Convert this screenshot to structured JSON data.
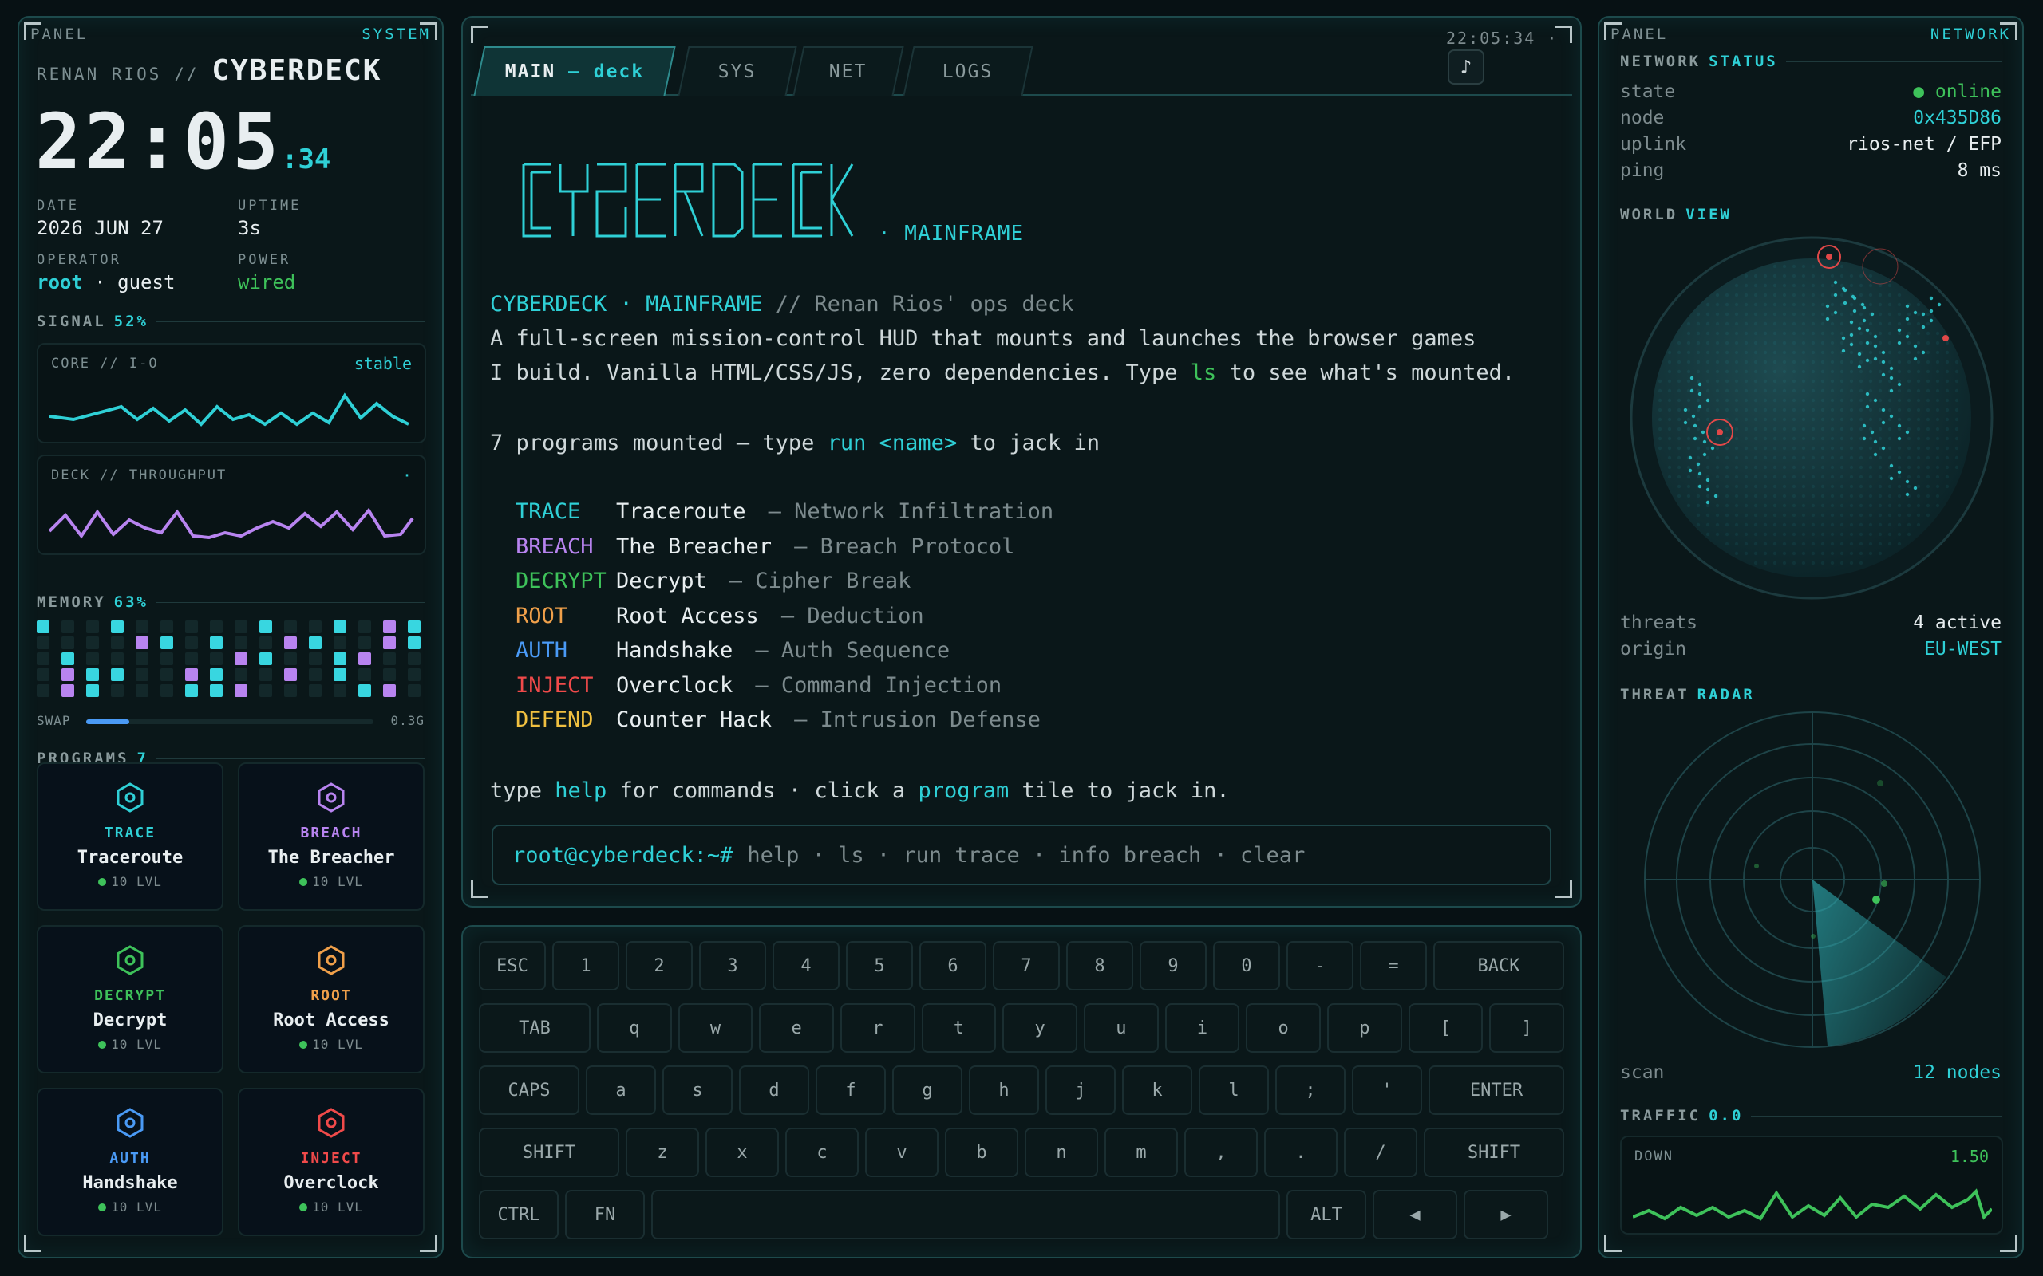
{
  "left": {
    "panel_label": "PANEL",
    "panel_tag": "SYSTEM",
    "owner": "RENAN RIOS //",
    "deck_name": "CYBERDECK",
    "clock_hm": "22:05",
    "clock_s": ":34",
    "date_label": "DATE",
    "date_value": "2026 JUN 27",
    "uptime_label": "UPTIME",
    "uptime_value": "3s",
    "operator_label": "OPERATOR",
    "operator_user": "root",
    "operator_sep": " · guest",
    "power_label": "POWER",
    "power_value": "wired",
    "signal_label": "SIGNAL",
    "signal_value": "52%",
    "core_label": "CORE // I-O",
    "core_status": "stable",
    "deck_label": "DECK // THROUGHPUT",
    "deck_status": "·",
    "memory_label": "MEMORY",
    "memory_value": "63%",
    "swap_label": "SWAP",
    "swap_value": "0.3G",
    "swap_fraction": 0.15,
    "programs_label": "PROGRAMS",
    "programs_count": "7",
    "programs": [
      {
        "code": "TRACE",
        "name": "Traceroute",
        "lvl": "10 LVL",
        "color": "#2fd0d6"
      },
      {
        "code": "BREACH",
        "name": "The Breacher",
        "lvl": "10 LVL",
        "color": "#b884f0"
      },
      {
        "code": "DECRYPT",
        "name": "Decrypt",
        "lvl": "10 LVL",
        "color": "#3ec25a"
      },
      {
        "code": "ROOT",
        "name": "Root Access",
        "lvl": "10 LVL",
        "color": "#f0a04a"
      },
      {
        "code": "AUTH",
        "name": "Handshake",
        "lvl": "10 LVL",
        "color": "#4a9af5"
      },
      {
        "code": "INJECT",
        "name": "Overclock",
        "lvl": "10 LVL",
        "color": "#f04a4a"
      }
    ]
  },
  "main": {
    "tabs": [
      {
        "label": "MAIN",
        "sub": " — deck"
      },
      {
        "label": "SYS"
      },
      {
        "label": "NET"
      },
      {
        "label": "LOGS"
      }
    ],
    "time": "22:05:34 ·",
    "music_icon": "♪",
    "logo_sub": "· MAINFRAME",
    "line1_a": "CYBERDECK · MAINFRAME",
    "line1_b": " // Renan Rios' ops deck",
    "line2": "A full-screen mission-control HUD that mounts and launches the browser games",
    "line3_a": "I build. Vanilla HTML/CSS/JS, zero dependencies. Type ",
    "line3_b": "ls",
    "line3_c": " to see what's mounted.",
    "mounted_a": "7 programs mounted — type ",
    "mounted_b": "run <name>",
    "mounted_c": " to jack in",
    "programs": [
      {
        "code": "TRACE",
        "name": "Traceroute",
        "desc": "— Network Infiltration",
        "color": "#2fd0d6"
      },
      {
        "code": "BREACH",
        "name": "The Breacher",
        "desc": "— Breach Protocol",
        "color": "#b884f0"
      },
      {
        "code": "DECRYPT",
        "name": "Decrypt",
        "desc": "— Cipher Break",
        "color": "#3ec25a"
      },
      {
        "code": "ROOT",
        "name": "Root Access",
        "desc": "— Deduction",
        "color": "#f0a04a"
      },
      {
        "code": "AUTH",
        "name": "Handshake",
        "desc": "— Auth Sequence",
        "color": "#4a9af5"
      },
      {
        "code": "INJECT",
        "name": "Overclock",
        "desc": "— Command Injection",
        "color": "#f04a4a"
      },
      {
        "code": "DEFEND",
        "name": "Counter Hack",
        "desc": "— Intrusion Defense",
        "color": "#f0c040"
      }
    ],
    "help_a": "type ",
    "help_b": "help",
    "help_c": " for commands · click a ",
    "help_d": "program",
    "help_e": " tile to jack in.",
    "prompt": "root@cyberdeck:~#",
    "input_placeholder": "help · ls · run trace · info breach · clear"
  },
  "keyboard": {
    "row1": [
      "ESC",
      "1",
      "2",
      "3",
      "4",
      "5",
      "6",
      "7",
      "8",
      "9",
      "0",
      "-",
      "=",
      "BACK"
    ],
    "row2": [
      "TAB",
      "q",
      "w",
      "e",
      "r",
      "t",
      "y",
      "u",
      "i",
      "o",
      "p",
      "[",
      "]"
    ],
    "row3": [
      "CAPS",
      "a",
      "s",
      "d",
      "f",
      "g",
      "h",
      "j",
      "k",
      "l",
      ";",
      "'",
      "ENTER"
    ],
    "row4": [
      "SHIFT",
      "z",
      "x",
      "c",
      "v",
      "b",
      "n",
      "m",
      ",",
      ".",
      "/",
      "SHIFT"
    ],
    "row5": [
      "CTRL",
      "FN",
      "",
      "ALT",
      "◀",
      "▶"
    ]
  },
  "right": {
    "panel_label": "PANEL",
    "panel_tag": "NETWORK",
    "status_label_a": "NETWORK",
    "status_label_b": "STATUS",
    "state_label": "state",
    "state_value": "● online",
    "node_label": "node",
    "node_value": "0x435D86",
    "uplink_label": "uplink",
    "uplink_value": "rios-net / EFP",
    "ping_label": "ping",
    "ping_value": "8 ms",
    "world_label_a": "WORLD",
    "world_label_b": "VIEW",
    "threats_label": "threats",
    "threats_value": "4 active",
    "origin_label": "origin",
    "origin_value": "EU-WEST",
    "radar_label_a": "THREAT",
    "radar_label_b": "RADAR",
    "scan_label": "scan",
    "scan_value": "12 nodes",
    "traffic_label": "TRAFFIC",
    "traffic_value": "0.0",
    "down_label": "DOWN",
    "down_value": "1.50"
  }
}
